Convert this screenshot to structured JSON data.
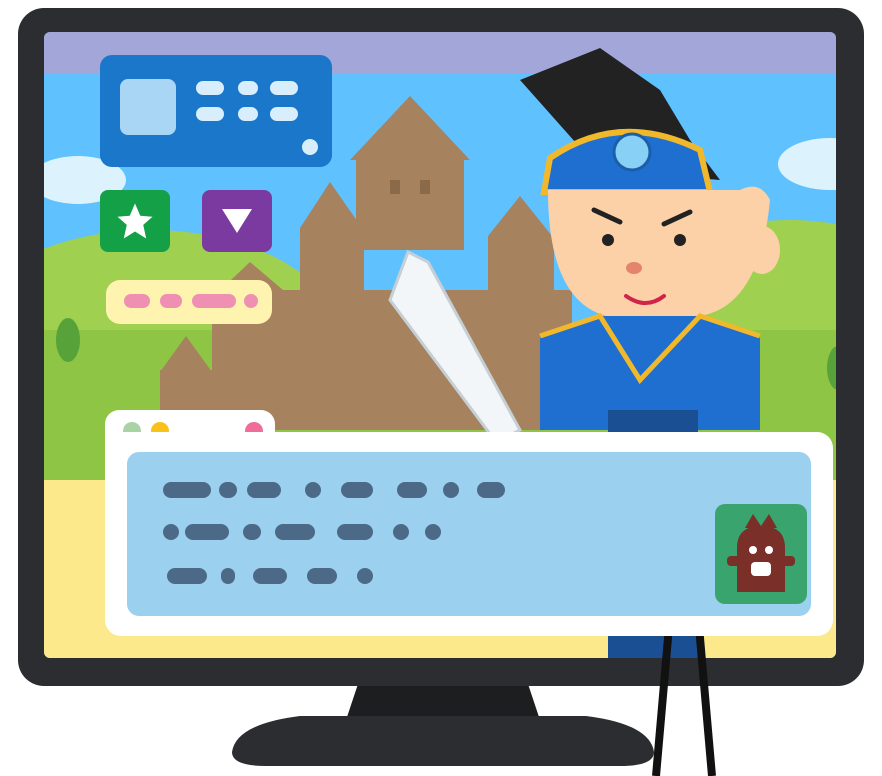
{
  "scene": "fantasy-rpg",
  "colors": {
    "sky": "#5fc2ff",
    "sky_band": "#a3a6d9",
    "monitor_bezel": "#2b2d30",
    "castle": "#a7825e",
    "hud_blue": "#1b77c9",
    "dialog_bg": "#9bd0ee",
    "skill_green": "#14a047",
    "skill_purple": "#7b3aa0",
    "ground_yellow": "#fbe98c"
  },
  "icons": {
    "skill_1": "star-icon",
    "skill_2": "triangle-down-icon",
    "dialog_next": "caret-down-icon",
    "speaker": "monster-portrait"
  },
  "hud": {
    "hp_segments": 4,
    "item_slots": 2
  },
  "dialog": {
    "lines": 3,
    "window_dots": [
      "#a9d3a5",
      "#f8c21b",
      "#ef6d9b"
    ]
  }
}
